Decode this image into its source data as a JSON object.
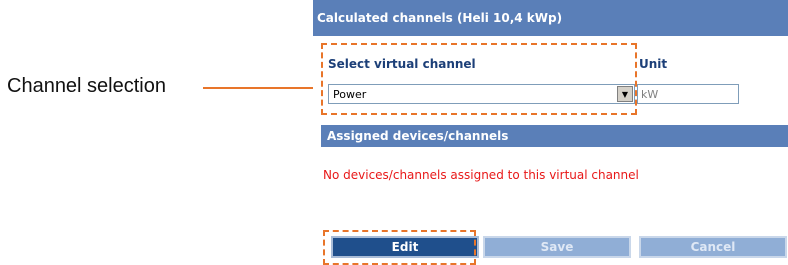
{
  "callout": {
    "label": "Channel selection"
  },
  "panel": {
    "title": "Calculated channels (Heli 10,4 kWp)",
    "select_label": "Select virtual channel",
    "unit_label": "Unit",
    "selected_channel": "Power",
    "unit_value": "kW",
    "assigned_header": "Assigned devices/channels",
    "no_devices_message": "No devices/channels assigned to this virtual channel"
  },
  "buttons": {
    "edit": "Edit",
    "save": "Save",
    "cancel": "Cancel"
  },
  "icons": {
    "dropdown": "chevron-down-icon"
  },
  "colors": {
    "header": "#5a7fb8",
    "label": "#1c3f78",
    "error_text": "#e81818",
    "highlight": "#e8752a",
    "primary_button": "#1f4f8c",
    "disabled_button": "#90aed6"
  }
}
